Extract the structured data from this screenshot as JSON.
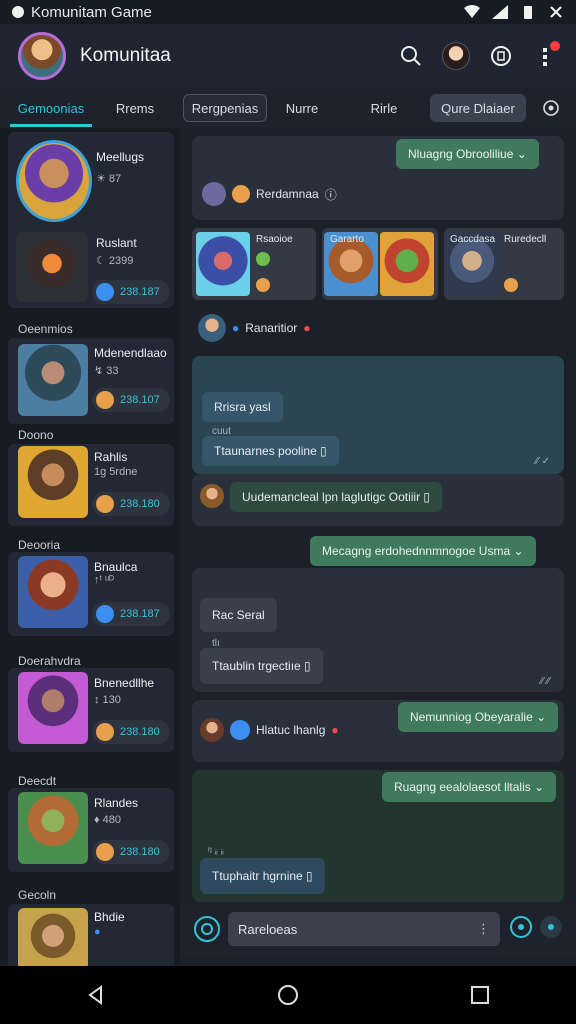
{
  "status": {
    "title": "Komunitam Game"
  },
  "header": {
    "title": "Komunitaa"
  },
  "tabs": [
    "Gemoonias",
    "Rrems",
    "Rergpenias",
    "Nurre",
    "Rirle",
    "Qure Dlaiaer"
  ],
  "sidebar": {
    "cards": [
      {
        "name": "Meellugs",
        "meta": "☀ 87"
      },
      {
        "name": "Ruslant",
        "meta": "☾ 2399",
        "pill": "238.187"
      }
    ],
    "sections": [
      {
        "label": "Oeenmios",
        "name": "Mdenendlaao",
        "meta": "↯ 33",
        "pill": "238.107"
      },
      {
        "label": "Doono",
        "name": "Rahlis",
        "meta": "1g 5rdne",
        "pill": "238.180"
      },
      {
        "label": "Deooria",
        "name": "Bnaulca",
        "meta": "↑ᵗ ᵘᴰ",
        "pill": "238.187"
      },
      {
        "label": "Doerahvdra",
        "name": "Bnenedllhe",
        "meta": "↕ 130",
        "pill": "238.180"
      },
      {
        "label": "Deecdt",
        "name": "Rlandes",
        "meta": "♦ 480",
        "pill": "238.180"
      },
      {
        "label": "Gecoln",
        "name": "Bhdie",
        "meta": ""
      }
    ]
  },
  "chat": {
    "p1_pill": "Nluagng Obrooliliue",
    "p1_line": "Rerdamnaa",
    "tiles": [
      {
        "name": "Rsaoioe"
      },
      {
        "name": "Gararto"
      },
      {
        "name": "Gaccdasa"
      },
      {
        "name": "Ruredecll"
      }
    ],
    "user_line": "Ranaritior",
    "teal_b1": "Rrisra yasl",
    "teal_small": "cuut",
    "teal_b2": "Ttaunarnes pooline ▯",
    "teal_line": "Uudemancleal lpn laglutigc Ootiiir ▯",
    "pill2": "Mecagng erdohednnmnogoe Usma",
    "dark_b1": "Rac Seral",
    "dark_small": "tlı",
    "dark_b2": "Ttaublin trgectiıe ▯",
    "pill3": "Nemunniog Obeyaralie",
    "hline": "Hlatuc lhanlg",
    "pill4": "Ruagng eealolaesot lltalis",
    "green_b": "Ttuphaitr hgrnine ▯",
    "green_small": "ᵑ ᵢᵢ ᵢᵢ"
  },
  "input": {
    "value": "Rareloeas"
  },
  "colors": {
    "accent": "#2fc7d6",
    "green": "#3f7a5c",
    "bg": "#1b2029"
  }
}
